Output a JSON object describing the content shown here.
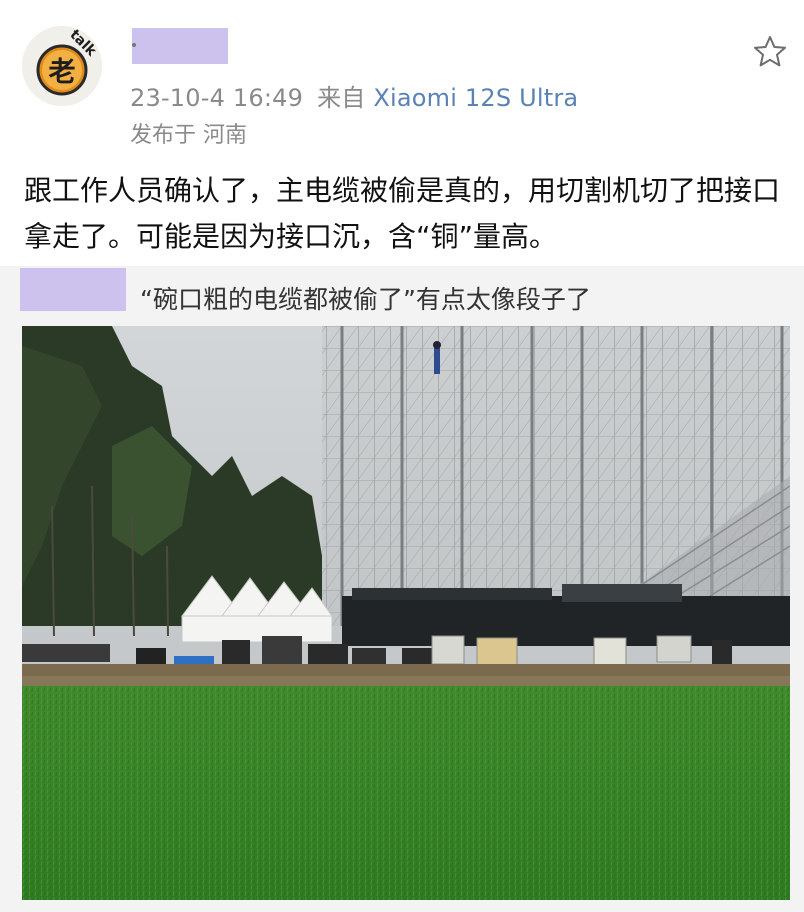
{
  "post": {
    "avatar": {
      "glyph": "老",
      "tag": "talk"
    },
    "timestamp": "23-10-4 16:49",
    "source_prefix": "来自",
    "device": "Xiaomi 12S Ultra",
    "location": "发布于 河南",
    "text": "跟工作人员确认了，主电缆被偷是真的，用切割机切了把接口拿走了。可能是因为接口沉，含“铜”量高。"
  },
  "quote": {
    "text": "“碗口粗的电缆都被偷了”有点太像段子了"
  },
  "icons": {
    "favorite": "star-outline-icon"
  },
  "colors": {
    "redaction": "#cdc2ee",
    "device_link": "#5a82b6",
    "meta_gray": "#8a8a8a",
    "quote_bg": "#f3f3f3"
  }
}
